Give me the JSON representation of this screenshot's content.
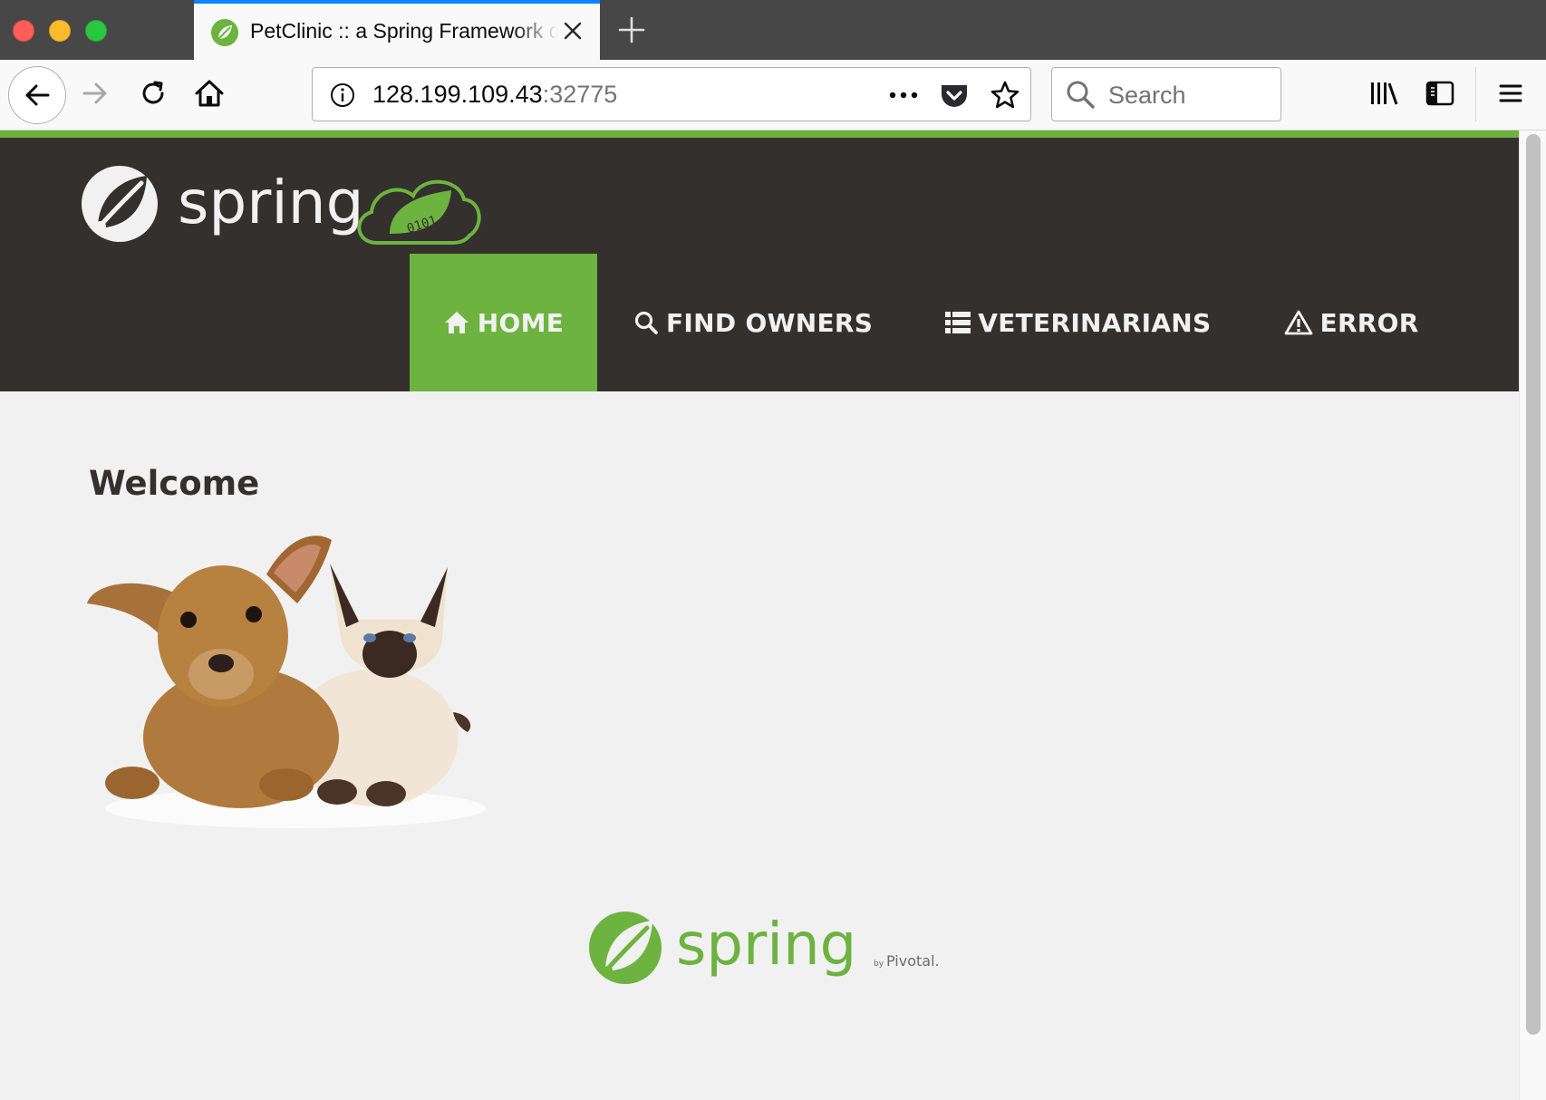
{
  "browser": {
    "tab": {
      "title": "PetClinic :: a Spring Framework demonstration",
      "favicon": "spring-leaf-icon"
    },
    "url": {
      "host": "128.199.109.43",
      "port": ":32775"
    },
    "search": {
      "placeholder": "Search"
    },
    "accent_color": "#0a84ff"
  },
  "app": {
    "brand": "spring",
    "brand_badge": "0101",
    "colors": {
      "navbar": "#34302d",
      "accent": "#6db33f",
      "page_bg": "#f1f1f1"
    },
    "nav": [
      {
        "label": "HOME",
        "icon": "home-icon",
        "active": true
      },
      {
        "label": "FIND OWNERS",
        "icon": "search-icon",
        "active": false
      },
      {
        "label": "VETERINARIANS",
        "icon": "list-icon",
        "active": false
      },
      {
        "label": "ERROR",
        "icon": "warning-icon",
        "active": false
      }
    ]
  },
  "main": {
    "heading": "Welcome"
  },
  "footer": {
    "brand": "spring",
    "by": "by",
    "company": "Pivotal."
  }
}
